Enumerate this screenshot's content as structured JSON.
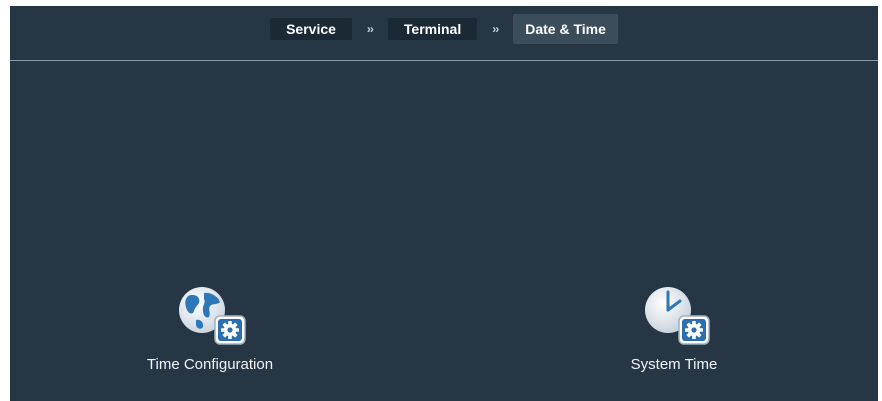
{
  "breadcrumb": [
    {
      "label": "Service"
    },
    {
      "label": "Terminal"
    },
    {
      "label": "Date & Time"
    }
  ],
  "separator": "››",
  "tiles": [
    {
      "label": "Time Configuration",
      "icon": "globe-gear-icon"
    },
    {
      "label": "System Time",
      "icon": "clock-gear-icon"
    }
  ],
  "colors": {
    "background": "#263645",
    "breadcrumb_item": "#1b2935",
    "breadcrumb_active": "#3b4c5b",
    "gear_badge": "#2b6fb0"
  }
}
